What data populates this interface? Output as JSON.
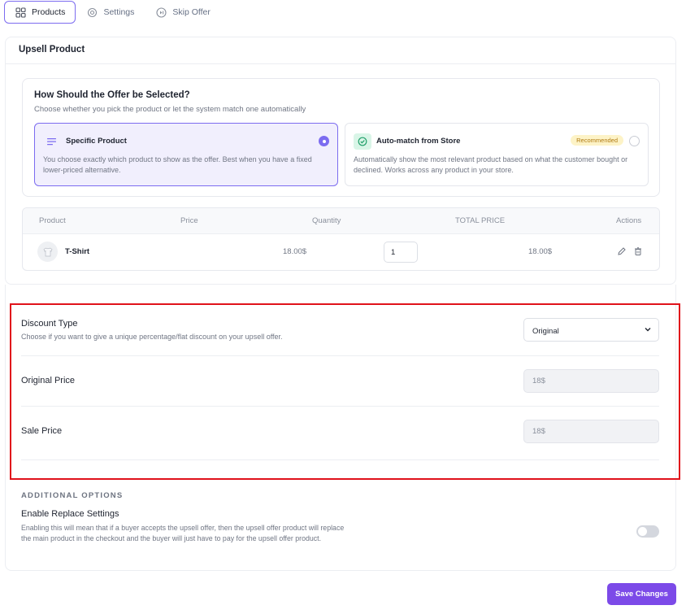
{
  "tabs": [
    {
      "label": "Products",
      "icon": "grid-icon",
      "active": true
    },
    {
      "label": "Settings",
      "icon": "gear-icon",
      "active": false
    },
    {
      "label": "Skip Offer",
      "icon": "skip-icon",
      "active": false
    }
  ],
  "card": {
    "title": "Upsell Product",
    "selection": {
      "title": "How Should the Offer be Selected?",
      "subtitle": "Choose whether you pick the product or let the system match one automatically",
      "options": [
        {
          "title": "Specific Product",
          "description": "You choose exactly which product to show as the offer. Best when you have a fixed lower-priced alternative.",
          "selected": true,
          "icon": "list-icon"
        },
        {
          "title": "Auto-match from Store",
          "description": "Automatically show the most relevant product based on what the customer bought or declined. Works across any product in your store.",
          "selected": false,
          "badge": "Recommended",
          "icon": "check-circle-icon"
        }
      ]
    },
    "table": {
      "headers": [
        "Product",
        "Price",
        "Quantity",
        "TOTAL PRICE",
        "Actions"
      ],
      "rows": [
        {
          "product": "T-Shirt",
          "price": "18.00$",
          "quantity": "1",
          "total": "18.00$"
        }
      ]
    }
  },
  "discount": {
    "type_label": "Discount Type",
    "type_desc": "Choose if you want to give a unique percentage/flat discount on your upsell offer.",
    "type_value": "Original",
    "original_label": "Original Price",
    "original_value": "18$",
    "sale_label": "Sale Price",
    "sale_value": "18$"
  },
  "additional": {
    "heading": "ADDITIONAL OPTIONS",
    "replace_title": "Enable Replace Settings",
    "replace_desc": "Enabling this will mean that if a buyer accepts the upsell offer, then the upsell offer product will replace the main product in the checkout and the buyer will just have to pay for the upsell offer product.",
    "replace_enabled": false
  },
  "save_label": "Save Changes",
  "colors": {
    "accent": "#7c6cf0",
    "primary_button": "#7c4ae8",
    "highlight_border": "#e0121b",
    "badge_bg": "#fdf3c7"
  }
}
